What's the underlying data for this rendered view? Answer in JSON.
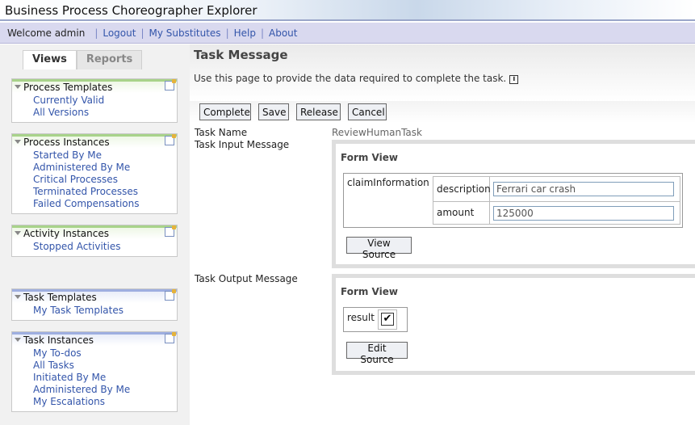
{
  "app": {
    "title": "Business Process Choreographer Explorer"
  },
  "navbar": {
    "welcome": "Welcome admin",
    "links": [
      "Logout",
      "My Substitutes",
      "Help",
      "About"
    ]
  },
  "left": {
    "tabs": [
      "Views",
      "Reports"
    ],
    "groups": [
      {
        "title": "Process Templates",
        "items": [
          "Currently Valid",
          "All Versions"
        ]
      },
      {
        "title": "Process Instances",
        "items": [
          "Started By Me",
          "Administered By Me",
          "Critical Processes",
          "Terminated Processes",
          "Failed Compensations"
        ]
      },
      {
        "title": "Activity Instances",
        "items": [
          "Stopped Activities"
        ]
      },
      {
        "title": "Task Templates",
        "items": [
          "My Task Templates"
        ]
      },
      {
        "title": "Task Instances",
        "items": [
          "My To-dos",
          "All Tasks",
          "Initiated By Me",
          "Administered By Me",
          "My Escalations"
        ]
      }
    ]
  },
  "page": {
    "title": "Task Message",
    "description": "Use this page to provide the data required to complete the task.",
    "info_icon": "i"
  },
  "toolbar": {
    "complete": "Complete",
    "save": "Save",
    "release": "Release",
    "cancel": "Cancel"
  },
  "task": {
    "name_label": "Task Name",
    "name_value": "ReviewHumanTask",
    "input_label": "Task Input Message",
    "output_label": "Task Output Message"
  },
  "input_form": {
    "heading": "Form View",
    "group": "claimInformation",
    "fields": [
      {
        "label": "description",
        "value": "Ferrari car crash"
      },
      {
        "label": "amount",
        "value": "125000"
      }
    ],
    "button": "View Source"
  },
  "output_form": {
    "heading": "Form View",
    "field_label": "result",
    "checked_mark": "✔",
    "checked": true,
    "button": "Edit Source"
  },
  "colors": {
    "link": "#3355aa",
    "nav_bg": "#d9d9ef",
    "green_header": "#a8d38a",
    "blue_header": "#9eaee0"
  },
  "icons": [
    "expand-triangle-icon",
    "edit-view-icon",
    "info-icon",
    "checkmark-icon"
  ]
}
